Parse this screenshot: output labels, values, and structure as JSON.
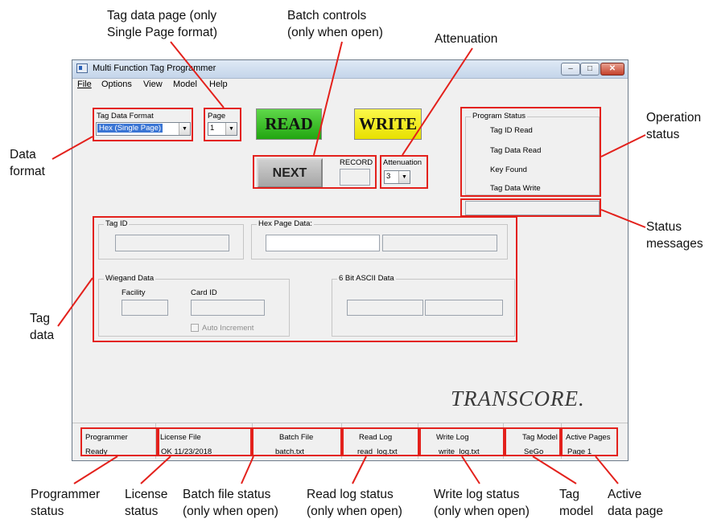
{
  "callouts": {
    "tag_data_page": "Tag data page (only\nSingle Page format)",
    "batch_controls": "Batch controls\n(only when open)",
    "attenuation": "Attenuation",
    "operation_status": "Operation\nstatus",
    "data_format": "Data\nformat",
    "status_messages": "Status\nmessages",
    "tag_data": "Tag\ndata",
    "programmer_status": "Programmer\nstatus",
    "license_status": "License\nstatus",
    "batch_file_status": "Batch file status\n(only when open)",
    "read_log_status": "Read log status\n(only when open)",
    "write_log_status": "Write log status\n(only when open)",
    "tag_model": "Tag\nmodel",
    "active_data_page": "Active\ndata page"
  },
  "window": {
    "title": "Multi Function Tag Programmer",
    "minimize": "–",
    "maximize": "□",
    "close": "✕"
  },
  "menu": [
    "File",
    "Options",
    "View",
    "Model",
    "Help"
  ],
  "format": {
    "label": "Tag Data Format",
    "value": "Hex (Single Page)"
  },
  "page": {
    "label": "Page",
    "value": "1"
  },
  "read_button": "READ",
  "write_button": "WRITE",
  "next_button": "NEXT",
  "record_label": "RECORD",
  "attenuation": {
    "label": "Attenuation",
    "value": "3"
  },
  "program_status": {
    "title": "Program Status",
    "items": [
      "Tag ID Read",
      "Tag Data Read",
      "Key Found",
      "Tag Data Write"
    ]
  },
  "tag_id": {
    "title": "Tag ID"
  },
  "hex_page": {
    "title": "Hex Page Data:"
  },
  "wiegand": {
    "title": "Wiegand Data",
    "facility": "Facility",
    "card_id": "Card ID",
    "auto_increment": "Auto Increment"
  },
  "ascii": {
    "title": "6 Bit ASCII Data"
  },
  "logo": "TRANSCORE.",
  "statusbar": [
    {
      "label": "Programmer",
      "value": "Ready"
    },
    {
      "label": "License File",
      "value": "OK 11/23/2018"
    },
    {
      "label": "Batch File",
      "value": "batch.txt"
    },
    {
      "label": "Read Log",
      "value": "read_log.txt"
    },
    {
      "label": "Write Log",
      "value": "write_log.txt"
    },
    {
      "label": "Tag Model",
      "value": "SeGo"
    },
    {
      "label": "Active Pages",
      "value": "Page 1"
    }
  ],
  "colors": {
    "annotation_red": "#e3211c",
    "read_green": "#33c21f",
    "write_yellow": "#f7f20f",
    "next_gray": "#b9b9b9"
  }
}
